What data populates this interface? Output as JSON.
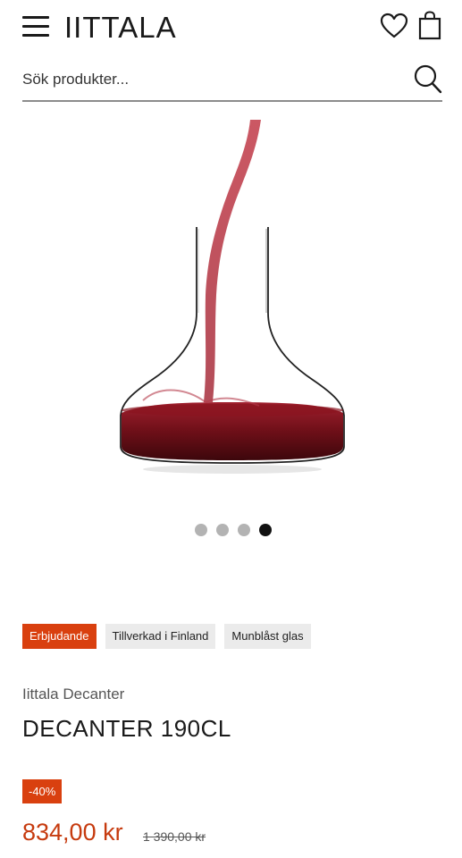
{
  "header": {
    "logo": "IITTALA"
  },
  "search": {
    "placeholder": "Sök produkter..."
  },
  "gallery": {
    "slide_count": 4,
    "active_slide": 4
  },
  "badges": [
    {
      "label": "Erbjudande"
    },
    {
      "label": "Tillverkad i Finland"
    },
    {
      "label": "Munblåst glas"
    }
  ],
  "product": {
    "brand": "Iittala Decanter",
    "title": "DECANTER 190CL",
    "discount": "-40%",
    "price": "834,00 kr",
    "old_price": "1 390,00 kr"
  },
  "colors": {
    "accent": "#d9400f",
    "price": "#c63a0e",
    "wine": "#8a1420"
  }
}
